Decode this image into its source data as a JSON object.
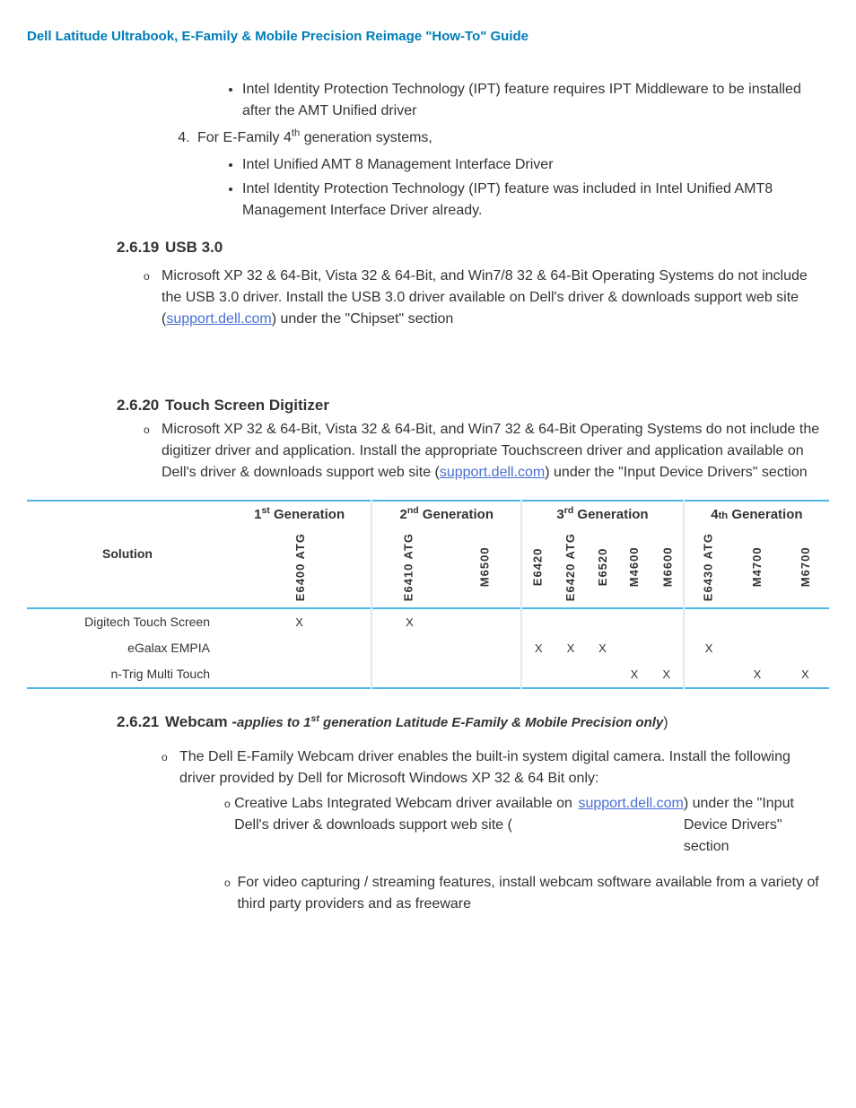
{
  "doc_title": "Dell Latitude Ultrabook, E-Family & Mobile Precision Reimage \"How-To\" Guide",
  "top_bullets": [
    "Intel Identity Protection Technology (IPT) feature requires IPT Middleware to be installed after the AMT Unified driver"
  ],
  "item4_label": "For E-Family 4",
  "item4_suffix": " generation systems,",
  "item4_bullets": [
    "Intel Unified AMT 8 Management Interface Driver",
    "Intel Identity Protection Technology (IPT) feature was included in Intel Unified AMT8 Management Interface Driver already."
  ],
  "sec_usb": {
    "num": "2.6.19",
    "title": "USB 3.0",
    "body_pre": "Microsoft XP 32 & 64-Bit, Vista 32 & 64-Bit, and Win7/8 32 & 64-Bit Operating Systems do not include the USB 3.0 driver. Install the USB 3.0 driver available on Dell's driver & downloads support web site (",
    "link": "support.dell.com",
    "body_post": ") under the \"Chipset\" section"
  },
  "sec_touch": {
    "num": "2.6.20",
    "title": "Touch Screen Digitizer",
    "body_pre": "Microsoft XP 32 & 64-Bit, Vista 32 & 64-Bit, and Win7 32 & 64-Bit Operating Systems do not include the digitizer driver and application. Install the  appropriate  Touchscreen driver and application available on Dell's driver & downloads support web site (",
    "link": "support.dell.com",
    "body_post": ") under the \"Input Device Drivers\" section"
  },
  "table": {
    "solution_label": "Solution",
    "gens": [
      "1st Generation",
      "2nd Generation",
      "3rd Generation",
      "4th Generation"
    ],
    "models": {
      "g1": [
        "E6400 ATG"
      ],
      "g2": [
        "E6410 ATG",
        "M6500"
      ],
      "g3": [
        "E6420",
        "E6420 ATG",
        "E6520",
        "M4600",
        "M6600"
      ],
      "g4": [
        "E6430 ATG",
        "M4700",
        "M6700"
      ]
    },
    "rows": [
      {
        "label": "Digitech Touch Screen",
        "cells": {
          "g1": [
            "X"
          ],
          "g2": [
            "X",
            ""
          ],
          "g3": [
            "",
            "",
            "",
            "",
            ""
          ],
          "g4": [
            "",
            "",
            ""
          ]
        }
      },
      {
        "label": "eGalax EMPIA",
        "cells": {
          "g1": [
            ""
          ],
          "g2": [
            "",
            ""
          ],
          "g3": [
            "X",
            "X",
            "X",
            "",
            ""
          ],
          "g4": [
            "X",
            "",
            ""
          ]
        }
      },
      {
        "label": "n-Trig Multi Touch",
        "cells": {
          "g1": [
            ""
          ],
          "g2": [
            "",
            ""
          ],
          "g3": [
            "",
            "",
            "",
            "X",
            "X"
          ],
          "g4": [
            "",
            "X",
            "X"
          ]
        }
      }
    ]
  },
  "sec_webcam": {
    "num": "2.6.21",
    "title": "Webcam -",
    "note_pre": "applies to 1",
    "note_post": " generation Latitude E-Family & Mobile Precision only",
    "paren": ")",
    "intro": "The Dell E-Family Webcam driver enables the built-in system digital camera. Install the following driver provided by Dell for Microsoft Windows XP 32 & 64 Bit only:",
    "ol1_pre": "Creative Labs Integrated Webcam driver available on Dell's driver & downloads support web site (",
    "ol1_link": "support.dell.com",
    "ol1_post": ") under the \"Input Device Drivers\" section",
    "ol2": "For video capturing / streaming features, install webcam software available from a variety of third party providers and as freeware"
  }
}
